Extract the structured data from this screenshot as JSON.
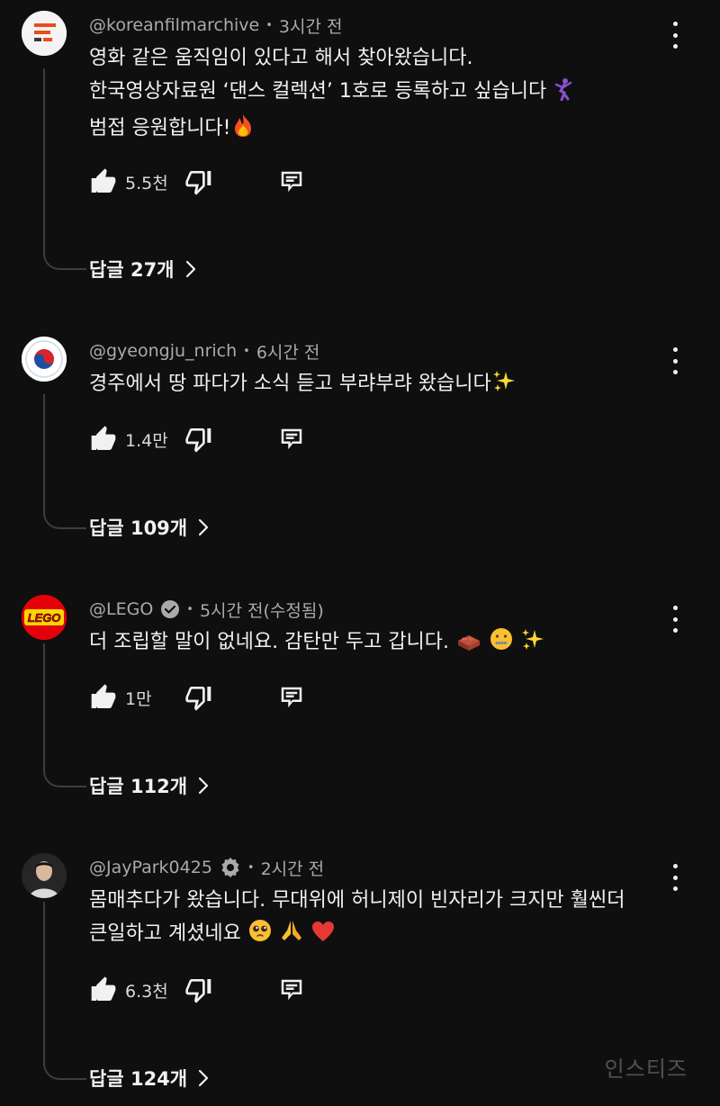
{
  "comments": [
    {
      "username": "@koreanfilmarchive",
      "time": "3시간 전",
      "lines": [
        "영화 같은 움직임이 있다고 해서 찾아왔습니다.",
        "한국영상자료원 ‘댄스 컬렉션’ 1호로 등록하고 싶습니다",
        "범접 응원합니다!"
      ],
      "likes": "5.5천",
      "replies": "답글 27개",
      "avatar": "koreanfilmarchive-logo"
    },
    {
      "username": "@gyeongju_nrich",
      "time": "6시간 전",
      "lines": [
        "경주에서 땅 파다가 소식 듣고 부랴부랴 왔습니다"
      ],
      "likes": "1.4만",
      "replies": "답글 109개",
      "avatar": "gyeongju-emblem"
    },
    {
      "username": "@LEGO",
      "time": "5시간 전(수정됨)",
      "lines": [
        "더 조립할 말이 없네요. 감탄만 두고 갑니다."
      ],
      "likes": "1만",
      "replies": "답글 112개",
      "avatar": "lego-logo",
      "verified": true
    },
    {
      "username": "@JayPark0425",
      "time": "2시간 전",
      "lines": [
        "몸매추다가 왔습니다. 무대위에 허니제이 빈자리가 크지만 훨씬더",
        "큰일하고 계셨네요"
      ],
      "likes": "6.3천",
      "replies": "답글 124개",
      "avatar": "jaypark-photo",
      "artist_badge": true
    }
  ],
  "watermark": "인스티즈",
  "colors": {
    "background": "#0f0f0f",
    "text": "#f1f1f1",
    "meta": "#aaaaaa",
    "thread_line": "#3d3d3d",
    "lego_red": "#e3000b"
  }
}
